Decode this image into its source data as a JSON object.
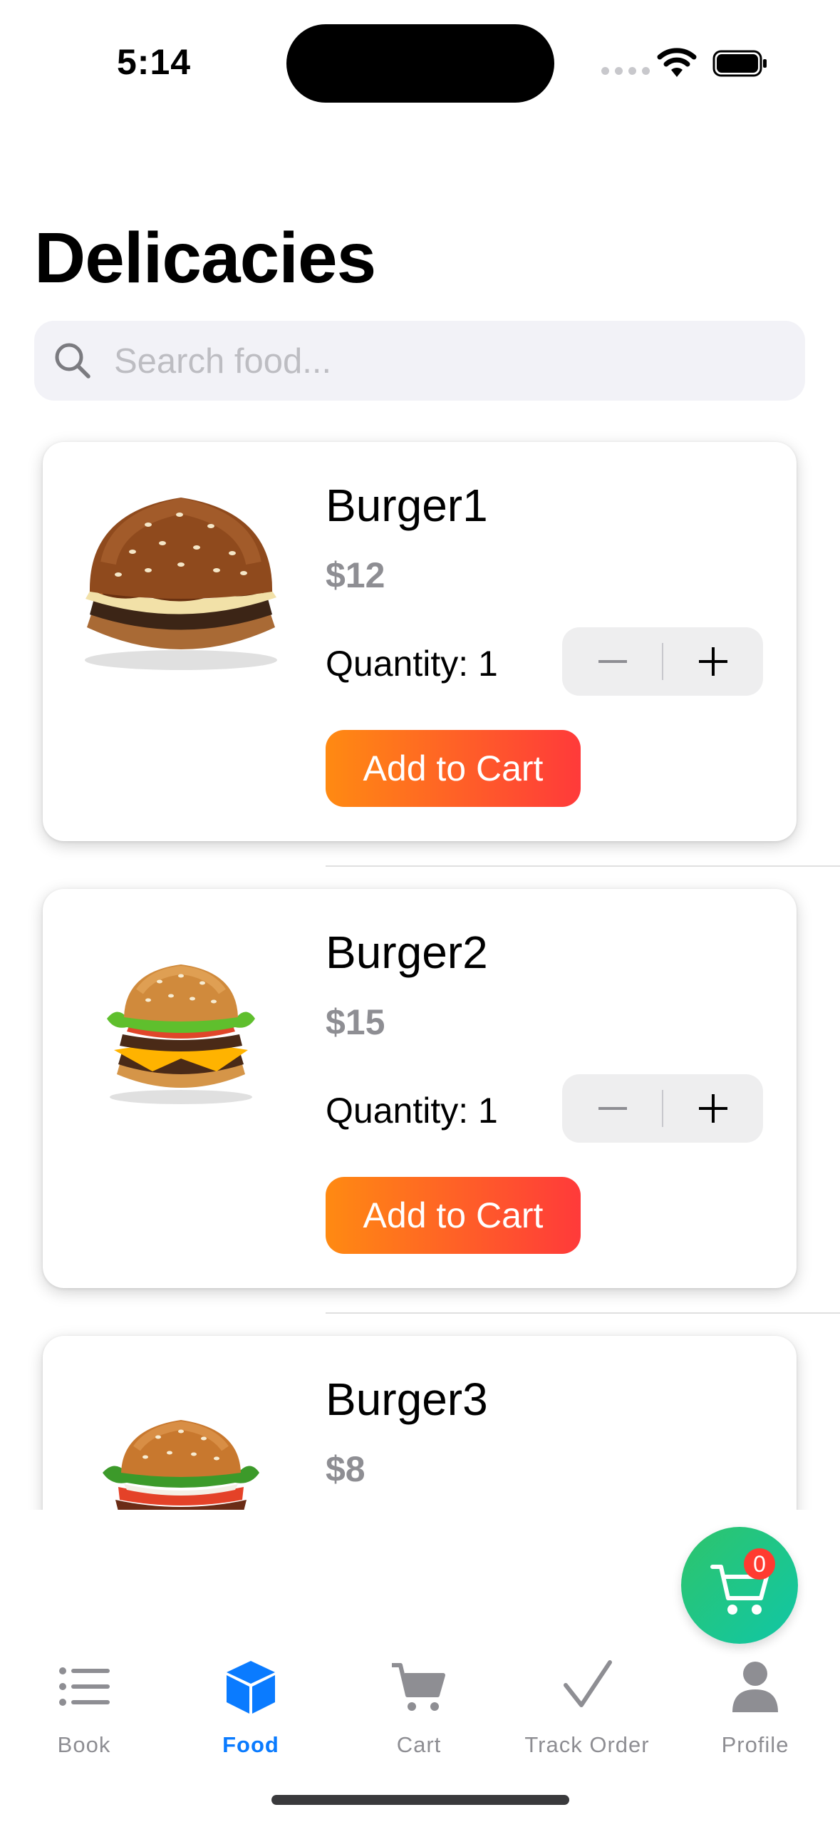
{
  "status_bar": {
    "time": "5:14"
  },
  "page_title": "Delicacies",
  "search": {
    "placeholder": "Search food...",
    "value": ""
  },
  "foods": [
    {
      "name": "Burger1",
      "price": "$12",
      "quantity_label": "Quantity: 1",
      "add_label": "Add to Cart"
    },
    {
      "name": "Burger2",
      "price": "$15",
      "quantity_label": "Quantity: 1",
      "add_label": "Add to Cart"
    },
    {
      "name": "Burger3",
      "price": "$8"
    }
  ],
  "cart_fab": {
    "badge_count": "0",
    "icon": "cart-icon"
  },
  "tabs": [
    {
      "label": "Book",
      "icon": "list-icon",
      "active": false
    },
    {
      "label": "Food",
      "icon": "box-icon",
      "active": true
    },
    {
      "label": "Cart",
      "icon": "cart-icon",
      "active": false
    },
    {
      "label": "Track Order",
      "icon": "checkmark-icon",
      "active": false
    },
    {
      "label": "Profile",
      "icon": "person-icon",
      "active": false
    }
  ],
  "colors": {
    "accent": "#0a7bff",
    "add_button_start": "#ff8a12",
    "add_button_end": "#ff3a3a",
    "fab": "#1ec48a",
    "badge": "#ff3b30",
    "tab_inactive": "#8e8e93"
  }
}
